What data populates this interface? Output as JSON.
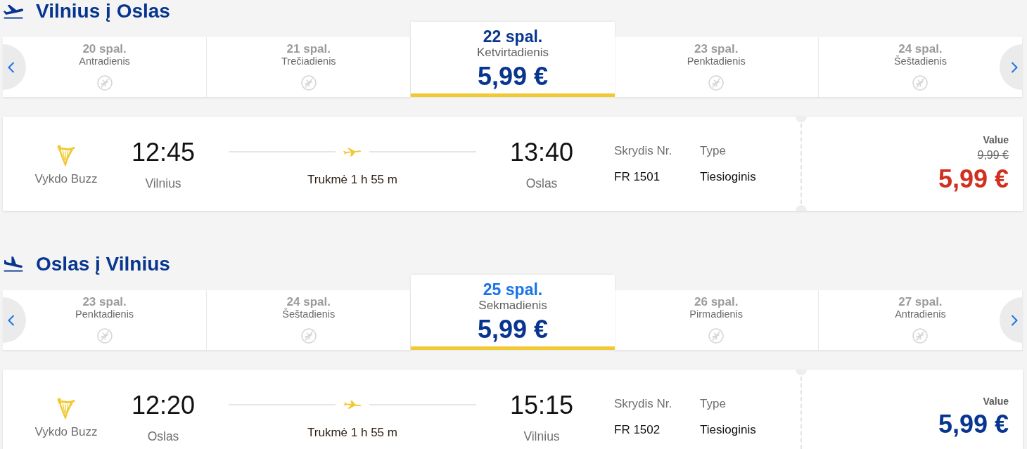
{
  "legs": [
    {
      "kind": "outbound",
      "title": "Vilnius į Oslas",
      "dates": [
        {
          "date": "20 spal.",
          "weekday": "Antradienis",
          "available": false,
          "selected": false
        },
        {
          "date": "21 spal.",
          "weekday": "Trečiadienis",
          "available": false,
          "selected": false
        },
        {
          "date": "22 spal.",
          "weekday": "Ketvirtadienis",
          "price": "5,99 €",
          "available": true,
          "selected": true,
          "color": "#073590"
        },
        {
          "date": "23 spal.",
          "weekday": "Penktadienis",
          "available": false,
          "selected": false
        },
        {
          "date": "24 spal.",
          "weekday": "Šeštadienis",
          "available": false,
          "selected": false
        }
      ],
      "flight": {
        "operator": "Vykdo Buzz",
        "departure_time": "12:45",
        "departure_city": "Vilnius",
        "duration": "Trukmė 1 h 55 m",
        "arrival_time": "13:40",
        "arrival_city": "Oslas",
        "flight_number_label": "Skrydis Nr.",
        "flight_number": "FR 1501",
        "type_label": "Type",
        "type": "Tiesioginis",
        "fare": {
          "label": "Value",
          "old_price": "9,99 €",
          "price": "5,99 €",
          "discounted": true
        }
      }
    },
    {
      "kind": "inbound",
      "title": "Oslas į Vilnius",
      "dates": [
        {
          "date": "23 spal.",
          "weekday": "Penktadienis",
          "available": false,
          "selected": false
        },
        {
          "date": "24 spal.",
          "weekday": "Šeštadienis",
          "available": false,
          "selected": false
        },
        {
          "date": "25 spal.",
          "weekday": "Sekmadienis",
          "price": "5,99 €",
          "available": true,
          "selected": true,
          "color": "#1a73e8"
        },
        {
          "date": "26 spal.",
          "weekday": "Pirmadienis",
          "available": false,
          "selected": false
        },
        {
          "date": "27 spal.",
          "weekday": "Antradienis",
          "available": false,
          "selected": false
        }
      ],
      "flight": {
        "operator": "Vykdo Buzz",
        "departure_time": "12:20",
        "departure_city": "Oslas",
        "duration": "Trukmė 1 h 55 m",
        "arrival_time": "15:15",
        "arrival_city": "Vilnius",
        "flight_number_label": "Skrydis Nr.",
        "flight_number": "FR 1502",
        "type_label": "Type",
        "type": "Tiesioginis",
        "fare": {
          "label": "Value",
          "price": "5,99 €",
          "discounted": false
        }
      }
    }
  ]
}
